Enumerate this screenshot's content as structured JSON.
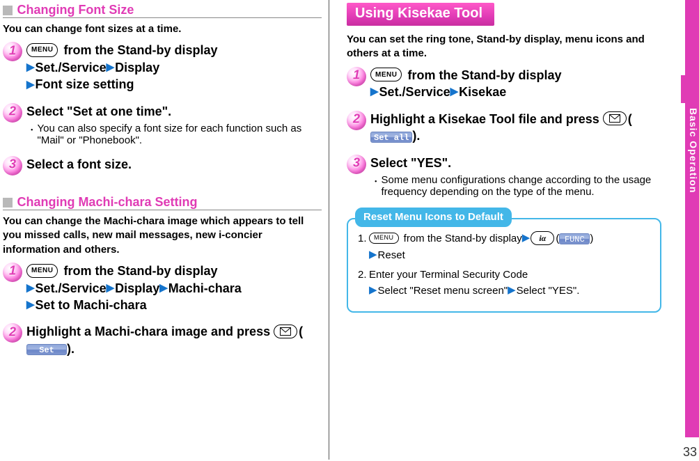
{
  "page_number": "33",
  "side_tab": "Basic Operation",
  "left": {
    "sec1": {
      "heading": "Changing Font Size",
      "intro": "You can change font sizes at a time.",
      "steps": {
        "s1": {
          "num": "1",
          "menu_key": "MENU",
          "p1_after_key": " from the Stand-by display",
          "p2_a": "Set./Service",
          "p2_b": "Display",
          "p3": "Font size setting"
        },
        "s2": {
          "num": "2",
          "lead": "Select \"Set at one time\".",
          "note": "You can also specify a font size for each function such as \"Mail\" or \"Phonebook\"."
        },
        "s3": {
          "num": "3",
          "lead": "Select a font size."
        }
      }
    },
    "sec2": {
      "heading": "Changing Machi-chara Setting",
      "intro": "You can change the Machi-chara image which appears to tell you missed calls, new mail messages, new i-concier information and others.",
      "steps": {
        "s1": {
          "num": "1",
          "menu_key": "MENU",
          "p1_after_key": " from the Stand-by display",
          "p2_a": "Set./Service",
          "p2_b": "Display",
          "p2_c": "Machi-chara",
          "p3": "Set to Machi-chara"
        },
        "s2": {
          "num": "2",
          "lead_a": "Highlight a Machi-chara image and press ",
          "lead_b_paren_open": "(",
          "pill": "Set",
          "lead_b_paren_close": ")."
        }
      }
    }
  },
  "right": {
    "banner": "Using Kisekae Tool",
    "intro": "You can set the ring tone, Stand-by display, menu icons and others at a time.",
    "steps": {
      "s1": {
        "num": "1",
        "menu_key": "MENU",
        "p1_after_key": " from the Stand-by display",
        "p2_a": "Set./Service",
        "p2_b": "Kisekae"
      },
      "s2": {
        "num": "2",
        "lead_a": "Highlight a Kisekae Tool file and press ",
        "paren_open": "(",
        "pill": "Set all",
        "paren_close": ")."
      },
      "s3": {
        "num": "3",
        "lead": "Select \"YES\".",
        "note": "Some menu configurations change according to the usage frequency depending on the type of the menu."
      }
    },
    "card": {
      "title": "Reset Menu Icons to Default",
      "r1_num": "1. ",
      "r1_menu_key": "MENU",
      "r1_a": " from the Stand-by display",
      "r1_ikey": "iα",
      "r1_paren_open": "(",
      "r1_pill": "FUNC",
      "r1_paren_close": ")",
      "r1_tri": "Reset",
      "r2_num": "2. ",
      "r2_a": "Enter your Terminal Security Code",
      "r2_b": "Select \"Reset menu screen\"",
      "r2_c": "Select \"YES\"."
    }
  }
}
